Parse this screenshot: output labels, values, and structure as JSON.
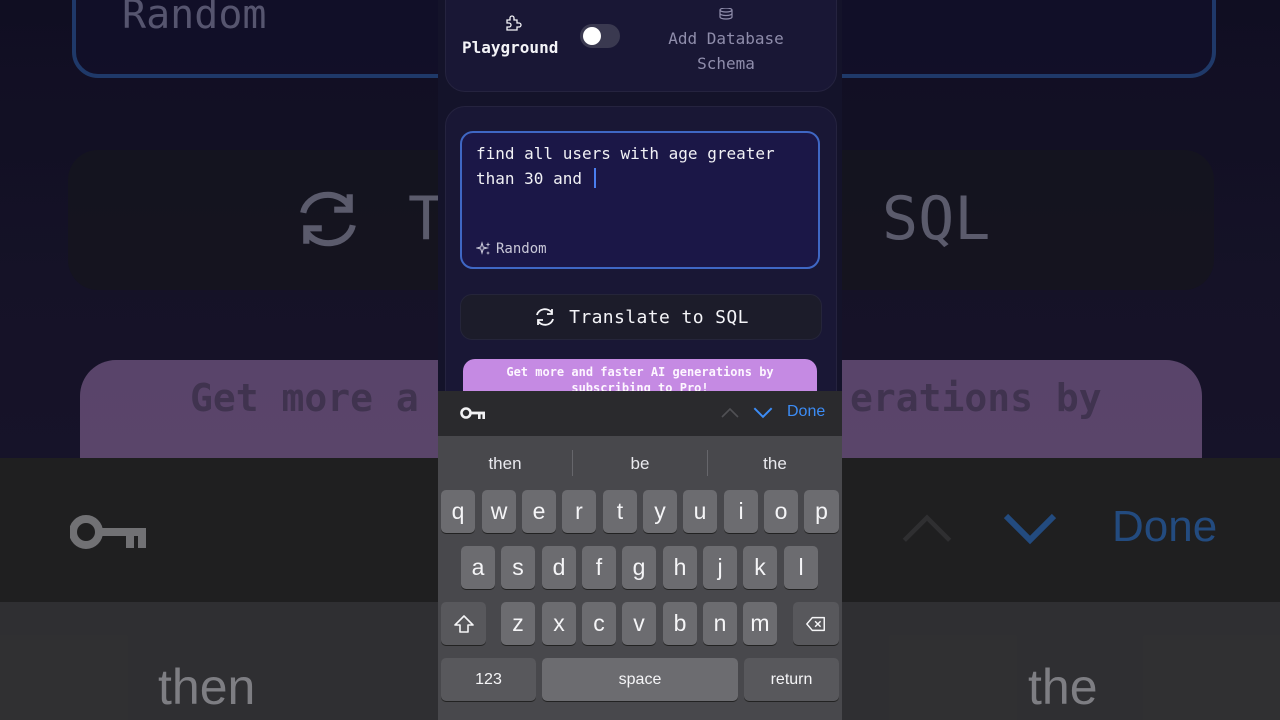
{
  "top": {
    "playground_label": "Playground",
    "playground_toggle_on": false,
    "add_schema_line1": "Add Database",
    "add_schema_line2": "Schema",
    "icons": [
      "puzzle-icon",
      "database-icon"
    ]
  },
  "query": {
    "text": "find all users with age greater\nthan 30 and ",
    "random_label": "Random"
  },
  "translate": {
    "label": "Translate to SQL"
  },
  "promo": {
    "text": "Get more and faster AI generations by subscribing to Pro!"
  },
  "keyboard": {
    "toolbar": {
      "done_label": "Done"
    },
    "suggestions": [
      "then",
      "be",
      "the"
    ],
    "row1": [
      "q",
      "w",
      "e",
      "r",
      "t",
      "y",
      "u",
      "i",
      "o",
      "p"
    ],
    "row2": [
      "a",
      "s",
      "d",
      "f",
      "g",
      "h",
      "j",
      "k",
      "l"
    ],
    "row3": [
      "z",
      "x",
      "c",
      "v",
      "b",
      "n",
      "m"
    ],
    "numbers_label": "123",
    "space_label": "space",
    "return_label": "return"
  },
  "background": {
    "random_label": "Random",
    "translate_left": "T",
    "translate_right": "SQL",
    "promo_left": "Get more a",
    "promo_right": "erations by",
    "done_label": "Done",
    "sug_left": "then",
    "sug_right": "the"
  },
  "colors": {
    "accent": "#3c8cf5",
    "query_border": "#3f67c4",
    "promo": "#c58ae3",
    "panel": "#191735"
  }
}
